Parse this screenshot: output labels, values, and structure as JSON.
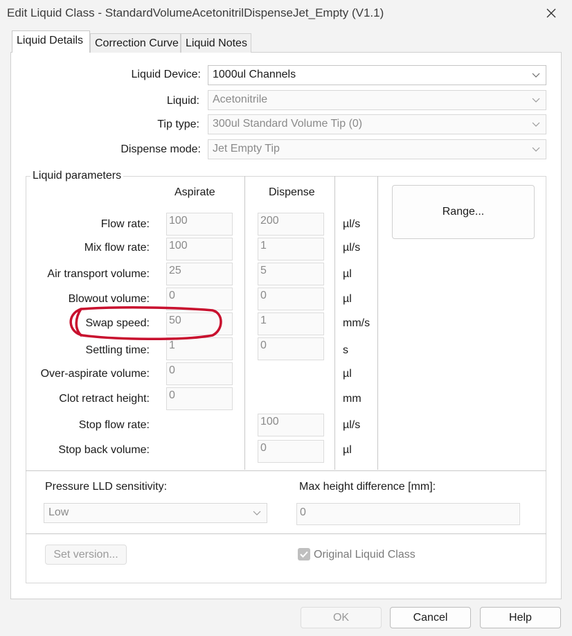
{
  "window": {
    "title": "Edit Liquid Class - StandardVolumeAcetonitrilDispenseJet_Empty (V1.1)",
    "close_icon": "close-icon"
  },
  "tabs": [
    {
      "label": "Liquid Details",
      "active": true
    },
    {
      "label": "Correction Curve",
      "active": false
    },
    {
      "label": "Liquid Notes",
      "active": false
    }
  ],
  "settings": {
    "liquid_device": {
      "label": "Liquid Device:",
      "value": "1000ul Channels"
    },
    "liquid": {
      "label": "Liquid:",
      "value": "Acetonitrile"
    },
    "tip_type": {
      "label": "Tip type:",
      "value": "300ul Standard Volume Tip (0)"
    },
    "dispense_mode": {
      "label": "Dispense mode:",
      "value": "Jet Empty Tip"
    }
  },
  "parameters": {
    "group_title": "Liquid parameters",
    "col_aspirate": "Aspirate",
    "col_dispense": "Dispense",
    "range_button": "Range...",
    "rows": [
      {
        "label": "Flow rate:",
        "aspirate": "100",
        "dispense": "200",
        "unit": "µl/s"
      },
      {
        "label": "Mix flow rate:",
        "aspirate": "100",
        "dispense": "1",
        "unit": "µl/s"
      },
      {
        "label": "Air transport volume:",
        "aspirate": "25",
        "dispense": "5",
        "unit": "µl"
      },
      {
        "label": "Blowout volume:",
        "aspirate": "0",
        "dispense": "0",
        "unit": "µl"
      },
      {
        "label": "Swap speed:",
        "aspirate": "50",
        "dispense": "1",
        "unit": "mm/s"
      },
      {
        "label": "Settling time:",
        "aspirate": "1",
        "dispense": "0",
        "unit": "s"
      },
      {
        "label": "Over-aspirate volume:",
        "aspirate": "0",
        "dispense": null,
        "unit": "µl"
      },
      {
        "label": "Clot retract height:",
        "aspirate": "0",
        "dispense": null,
        "unit": "mm"
      },
      {
        "label": "Stop flow rate:",
        "aspirate": null,
        "dispense": "100",
        "unit": "µl/s"
      },
      {
        "label": "Stop back volume:",
        "aspirate": null,
        "dispense": "0",
        "unit": "µl"
      }
    ]
  },
  "lld": {
    "label": "Pressure LLD sensitivity:",
    "value": "Low",
    "max_height_label": "Max height difference [mm]:",
    "max_height_value": "0"
  },
  "version": {
    "set_version_button": "Set version...",
    "original_checkbox_label": "Original Liquid Class",
    "original_checked": true
  },
  "footer": {
    "ok": "OK",
    "cancel": "Cancel",
    "help": "Help"
  },
  "annotation": {
    "color": "#c8102e"
  }
}
